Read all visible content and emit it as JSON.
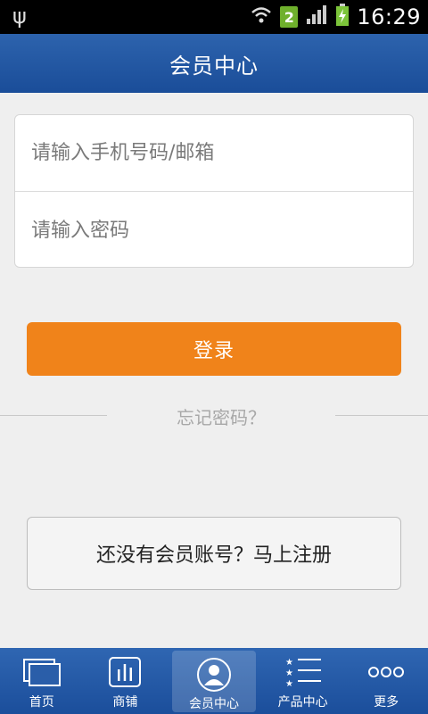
{
  "status_bar": {
    "time": "16:29",
    "sim_slot": "2"
  },
  "header": {
    "title": "会员中心"
  },
  "form": {
    "username_placeholder": "请输入手机号码/邮箱",
    "password_placeholder": "请输入密码",
    "login_label": "登录",
    "forgot_label": "忘记密码？",
    "register_label": "还没有会员账号？马上注册"
  },
  "tabs": [
    {
      "label": "首页",
      "icon": "home-icon"
    },
    {
      "label": "商铺",
      "icon": "shop-icon"
    },
    {
      "label": "会员中心",
      "icon": "member-icon",
      "active": true
    },
    {
      "label": "产品中心",
      "icon": "product-list-icon"
    },
    {
      "label": "更多",
      "icon": "more-icon"
    }
  ],
  "colors": {
    "header_blue": "#1a4d99",
    "login_orange": "#f0831a"
  }
}
